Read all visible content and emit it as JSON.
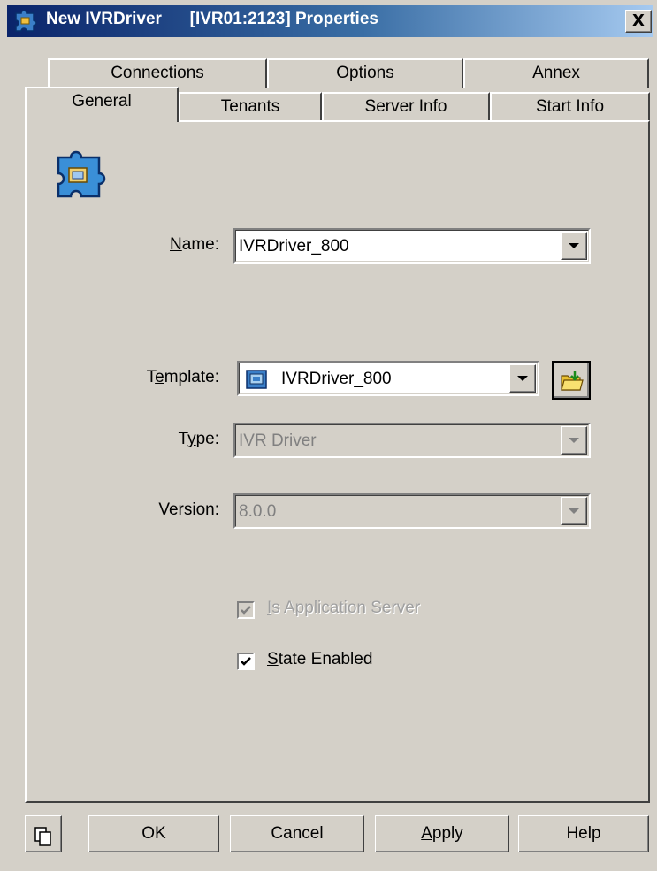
{
  "window": {
    "title_app": "New IVRDriver",
    "title_id": "[IVR01:2123] Properties",
    "close_label": "X"
  },
  "tabs": {
    "row_back": [
      "Connections",
      "Options",
      "Annex"
    ],
    "row_front": [
      "General",
      "Tenants",
      "Server Info",
      "Start Info"
    ],
    "active": "General"
  },
  "form": {
    "name_label": "Name:",
    "name_value": "IVRDriver_800",
    "template_label": "Template:",
    "template_value": "IVRDriver_800",
    "type_label": "Type:",
    "type_value": "IVR Driver",
    "version_label": "Version:",
    "version_value": "8.0.0",
    "is_app_server_label": "Is Application Server",
    "is_app_server_checked": true,
    "is_app_server_disabled": true,
    "state_enabled_label": "State Enabled",
    "state_enabled_checked": true
  },
  "buttons": {
    "ok": "OK",
    "cancel": "Cancel",
    "apply": "Apply",
    "help": "Help"
  },
  "icons": {
    "title": "ivr-driver-icon",
    "header": "ivr-driver-large-icon",
    "template_item": "template-icon",
    "template_browse": "folder-open-icon",
    "copy": "copy-icon"
  }
}
